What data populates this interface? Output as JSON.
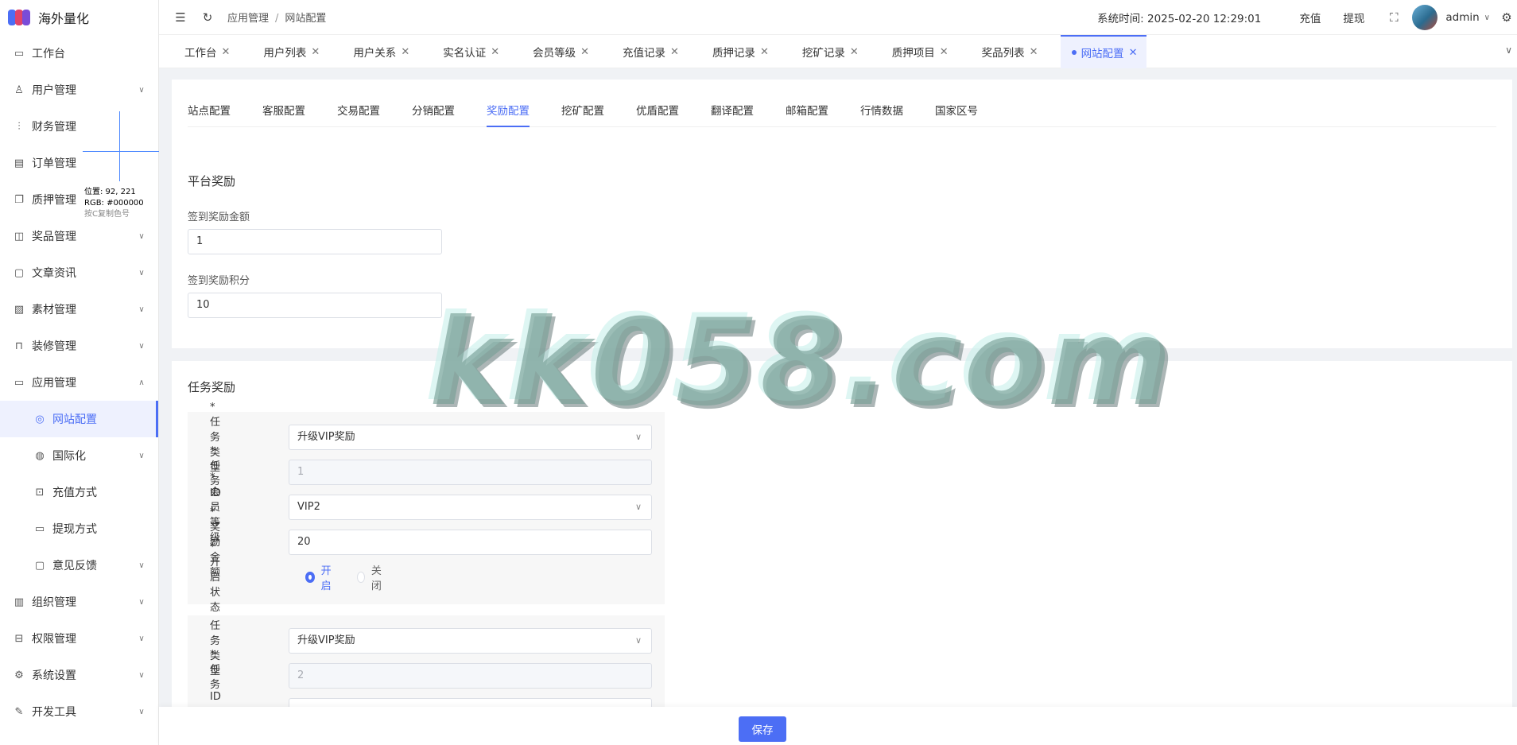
{
  "app": {
    "title": "海外量化"
  },
  "sidebar": {
    "items": [
      {
        "label": "工作台",
        "icon": "monitor-icon",
        "chevron": ""
      },
      {
        "label": "用户管理",
        "icon": "user-icon",
        "chevron": "⌄"
      },
      {
        "label": "财务管理",
        "icon": "chart-icon",
        "chevron": ""
      },
      {
        "label": "订单管理",
        "icon": "document-icon",
        "chevron": ""
      },
      {
        "label": "质押管理",
        "icon": "copy-icon",
        "chevron": ""
      },
      {
        "label": "奖品管理",
        "icon": "bag-icon",
        "chevron": "⌄"
      },
      {
        "label": "文章资讯",
        "icon": "message-icon",
        "chevron": "⌄"
      },
      {
        "label": "素材管理",
        "icon": "image-icon",
        "chevron": "⌄"
      },
      {
        "label": "装修管理",
        "icon": "brush-icon",
        "chevron": "⌄"
      },
      {
        "label": "应用管理",
        "icon": "app-icon",
        "chevron": "⌃"
      },
      {
        "label": "网站配置",
        "icon": "basketball-icon",
        "chevron": ""
      },
      {
        "label": "国际化",
        "icon": "globe-icon",
        "chevron": "⌄"
      },
      {
        "label": "充值方式",
        "icon": "wallet-icon",
        "chevron": ""
      },
      {
        "label": "提现方式",
        "icon": "folder-icon",
        "chevron": ""
      },
      {
        "label": "意见反馈",
        "icon": "feedback-icon",
        "chevron": "⌄"
      },
      {
        "label": "组织管理",
        "icon": "building-icon",
        "chevron": "⌄"
      },
      {
        "label": "权限管理",
        "icon": "lock-icon",
        "chevron": "⌄"
      },
      {
        "label": "系统设置",
        "icon": "gear-icon",
        "chevron": "⌄"
      },
      {
        "label": "开发工具",
        "icon": "pen-icon",
        "chevron": "⌄"
      }
    ]
  },
  "color_picker": {
    "position": "位置: 92, 221",
    "rgb": "RGB: #000000",
    "hint": "按C复制色号"
  },
  "header": {
    "breadcrumb": [
      "应用管理",
      "网站配置"
    ],
    "sep": "/",
    "system_time": "系统时间: 2025-02-20 12:29:01",
    "recharge": "充值",
    "withdraw": "提现",
    "user": "admin"
  },
  "tabs": [
    "工作台",
    "用户列表",
    "用户关系",
    "实名认证",
    "会员等级",
    "充值记录",
    "质押记录",
    "挖矿记录",
    "质押项目",
    "奖品列表",
    "网站配置"
  ],
  "subtabs": [
    "站点配置",
    "客服配置",
    "交易配置",
    "分销配置",
    "奖励配置",
    "挖矿配置",
    "优盾配置",
    "翻译配置",
    "邮箱配置",
    "行情数据",
    "国家区号"
  ],
  "platform": {
    "title": "平台奖励",
    "signin_amount_label": "签到奖励金额",
    "signin_amount": "1",
    "signin_points_label": "签到奖励积分",
    "signin_points": "10"
  },
  "tasks": {
    "title": "任务奖励",
    "labels": {
      "type": "* 任务类型",
      "id": "* 任务ID",
      "level": "* 会员等级",
      "amount": "* 奖励金额",
      "status": "* 开启状态"
    },
    "status_on": "开启",
    "status_off": "关闭",
    "items": [
      {
        "type": "升级VIP奖励",
        "id": "1",
        "level": "VIP2",
        "amount": "20",
        "enabled": true
      },
      {
        "type": "升级VIP奖励",
        "id": "2"
      }
    ]
  },
  "footer": {
    "save": "保存"
  },
  "watermark": "kk058.com",
  "colors": {
    "accent": "#4c6ef5"
  }
}
